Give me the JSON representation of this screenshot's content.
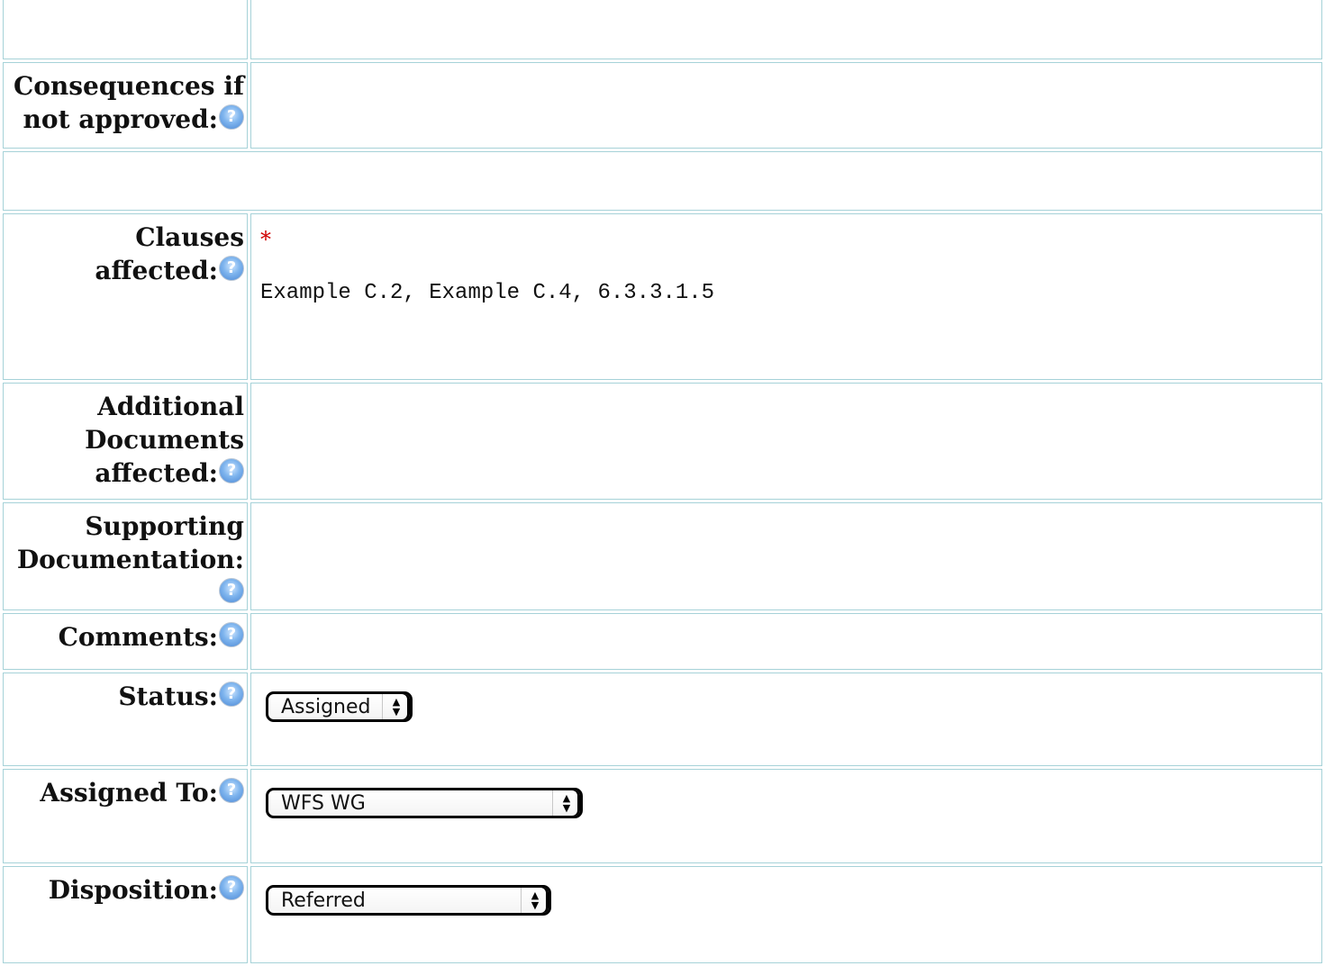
{
  "rows": {
    "top_blank": {},
    "consequences": {
      "label_line1": "Consequences if",
      "label_line2": "not approved:"
    },
    "spacer": {},
    "clauses": {
      "label_line1": "Clauses",
      "label_line2": "affected:",
      "required_marker": "*",
      "value": "Example C.2, Example C.4, 6.3.3.1.5"
    },
    "additional_docs": {
      "label_line1": "Additional",
      "label_line2": "Documents",
      "label_line3": "affected:"
    },
    "supporting_docs": {
      "label_line1": "Supporting",
      "label_line2": "Documentation:"
    },
    "comments": {
      "label": "Comments:"
    },
    "status": {
      "label": "Status:",
      "selected": "Assigned"
    },
    "assigned_to": {
      "label": "Assigned To:",
      "selected": "WFS WG"
    },
    "disposition": {
      "label": "Disposition:",
      "selected": "Referred"
    }
  },
  "icons": {
    "help": "help-question-icon"
  }
}
